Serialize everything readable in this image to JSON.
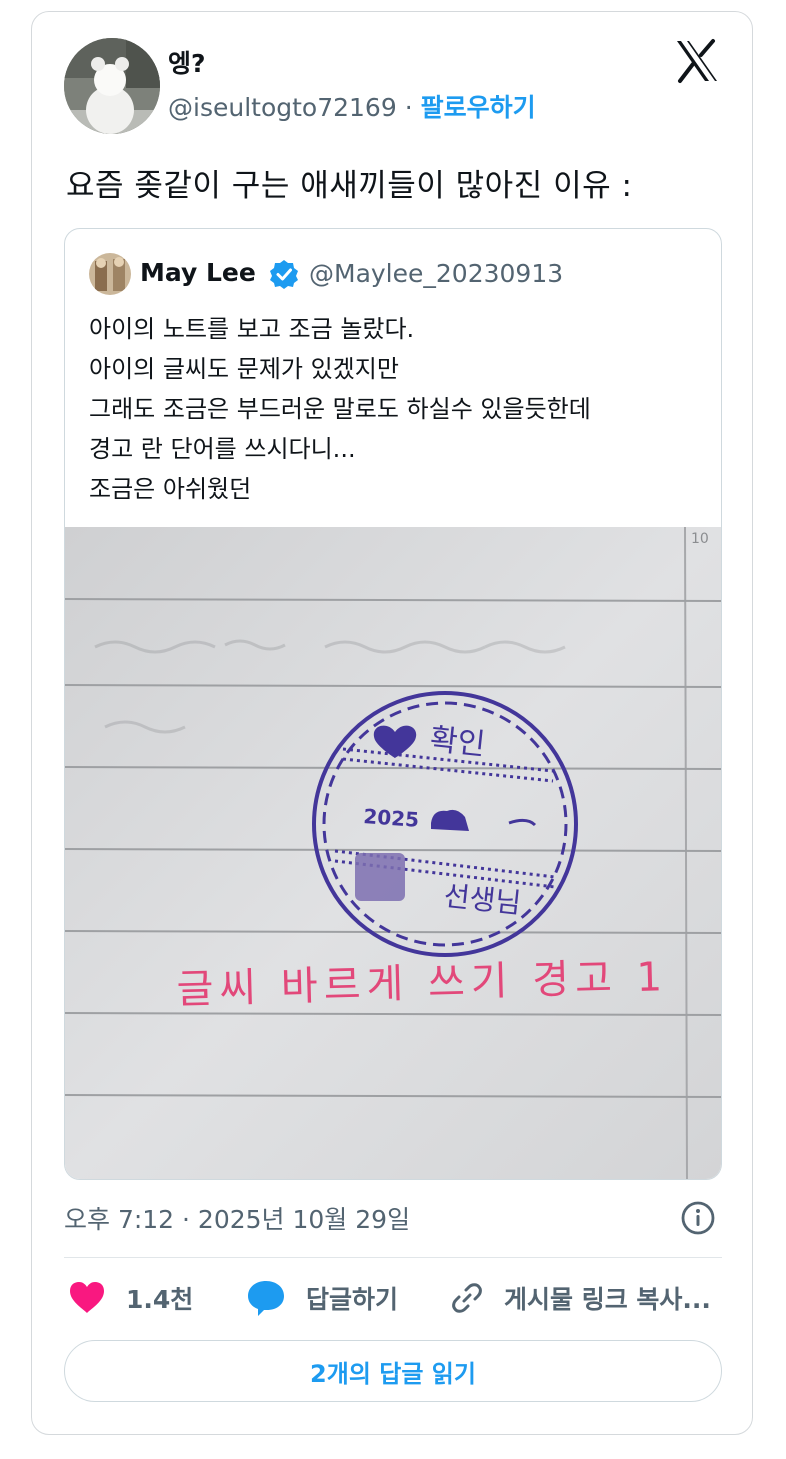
{
  "tweet": {
    "display_name": "엥?",
    "handle": "@iseultogto72169",
    "separator": "·",
    "follow_label": "팔로우하기",
    "text": "요즘 좆같이 구는 애새끼들이 많아진 이유 :"
  },
  "quote": {
    "name": "May Lee",
    "handle": "@Maylee_20230913",
    "lines": [
      "아이의 노트를 보고 조금 놀랐다.",
      "아이의 글씨도 문제가 있겠지만",
      "그래도 조금은 부드러운 말로도 하실수 있을듯한데",
      "경고 란 단어를 쓰시다니...",
      "조금은 아쉬웠던"
    ],
    "photo": {
      "page_number": "10",
      "stamp_top": "확인",
      "stamp_year": "2025",
      "stamp_bottom": "선생님",
      "handwriting": "글씨 바르게 쓰기 경고 1"
    }
  },
  "meta": {
    "timestamp": "오후 7:12 · 2025년 10월 29일"
  },
  "actions": {
    "likes": "1.4천",
    "reply": "답글하기",
    "copy_link": "게시물 링크 복사..."
  },
  "read_replies": "2개의 답글 읽기",
  "colors": {
    "accent": "#1d9bf0",
    "like": "#f91880",
    "text": "#0f1419",
    "secondary": "#536471",
    "stamp": "#43369a",
    "pen": "#e2487a"
  },
  "icons": [
    "x-logo-icon",
    "verified-badge-icon",
    "info-icon",
    "heart-icon",
    "reply-bubble-icon",
    "link-icon"
  ]
}
